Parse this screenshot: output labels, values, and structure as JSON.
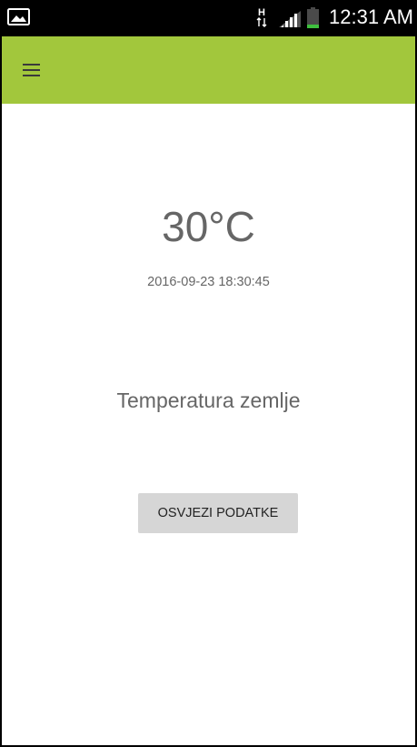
{
  "status_bar": {
    "time": "12:31 AM",
    "icons": [
      "image-icon",
      "network-type-icon",
      "signal-icon",
      "battery-icon"
    ]
  },
  "app_bar": {
    "color": "#a2c73c",
    "menu_icon": "hamburger-menu-icon"
  },
  "main": {
    "temperature": "30°C",
    "timestamp": "2016-09-23 18:30:45",
    "label": "Temperatura zemlje",
    "refresh_button": "OSVJEZI PODATKE"
  }
}
